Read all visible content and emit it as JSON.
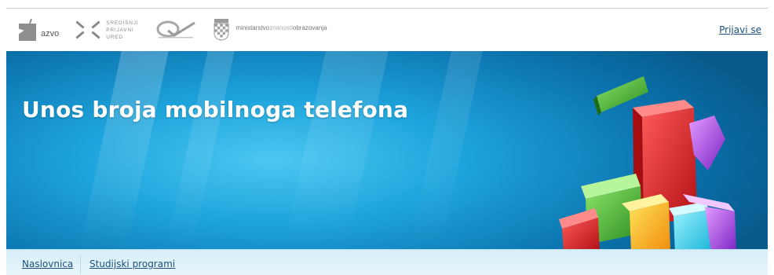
{
  "header": {
    "logos": {
      "azvo": "azvo",
      "spu": [
        "SREDIŠNJI",
        "PRIJAVNI",
        "URED"
      ],
      "ministry_parts": [
        "ministarstvo",
        "znanosti",
        "obrazovanja"
      ]
    },
    "login_label": "Prijavi se"
  },
  "hero": {
    "title": "Unos broja mobilnoga telefona"
  },
  "nav": {
    "items": [
      {
        "label": "Naslovnica"
      },
      {
        "label": "Studijski programi"
      }
    ]
  },
  "colors": {
    "hero_blue": "#1ea4dc",
    "link": "#1b4f80",
    "nav_bg": "#d5eef7"
  }
}
